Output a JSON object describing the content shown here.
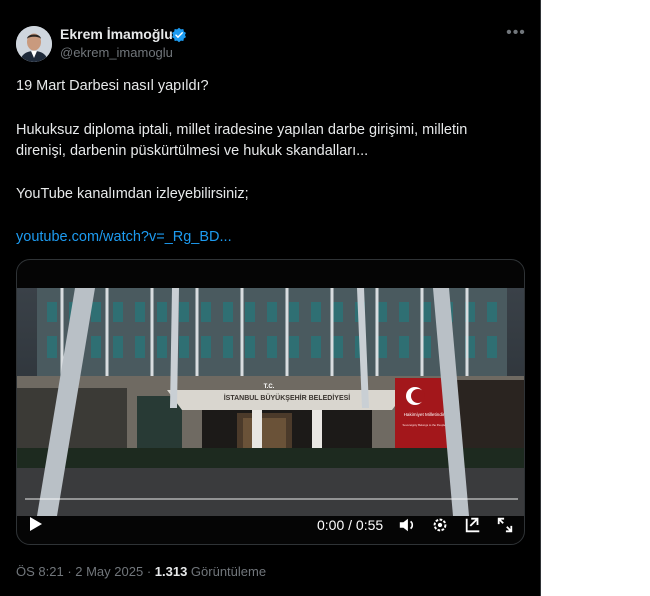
{
  "author": {
    "name": "Ekrem İmamoğlu",
    "handle": "@ekrem_imamoglu",
    "verified_color": "#1d9bf0"
  },
  "tweet": {
    "line1": "19 Mart Darbesi nasıl yapıldı?",
    "line2a": "Hukuksuz diploma iptali, millet iradesine yapılan darbe girişimi, milletin",
    "line2b": "direnişi, darbenin püskürtülmesi ve hukuk skandalları...",
    "line3": "YouTube kanalımdan izleyebilirsiniz;",
    "link": "youtube.com/watch?v=_Rg_BD..."
  },
  "video": {
    "building_sign_top": "T.C.",
    "building_sign": "İSTANBUL BÜYÜKŞEHİR BELEDİYESİ",
    "banner_line1": "Hakimiyet Milletindir",
    "banner_line2": "Sovereignty Belongs to the People",
    "time": "0:00 / 0:55",
    "progress": 0
  },
  "meta": {
    "time": "ÖS 8:21",
    "sep1": " · ",
    "date": "2 May 2025",
    "sep2": " · ",
    "views": "1.313",
    "views_label": " Görüntüleme"
  },
  "icons": [
    "verified-badge-icon",
    "more-icon",
    "play-icon",
    "volume-icon",
    "settings-icon",
    "pop-out-icon",
    "fullscreen-icon"
  ]
}
